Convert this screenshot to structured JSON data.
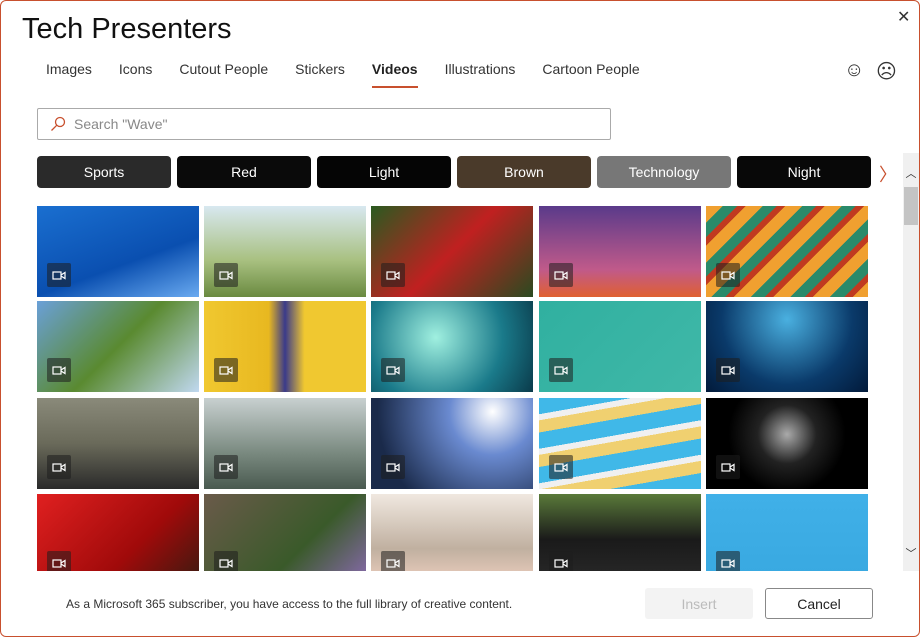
{
  "window": {
    "title": "Tech Presenters",
    "close_icon": "close-icon"
  },
  "tabs": [
    {
      "label": "Images"
    },
    {
      "label": "Icons"
    },
    {
      "label": "Cutout People"
    },
    {
      "label": "Stickers"
    },
    {
      "label": "Videos",
      "active": true
    },
    {
      "label": "Illustrations"
    },
    {
      "label": "Cartoon People"
    }
  ],
  "feedback": {
    "happy": "☺",
    "sad": "☹"
  },
  "search": {
    "placeholder": "Search \"Wave\"",
    "value": ""
  },
  "chips": [
    {
      "label": "Sports",
      "bg": "#2a2a2a"
    },
    {
      "label": "Red",
      "bg": "#0a0a0a"
    },
    {
      "label": "Light",
      "bg": "#050505"
    },
    {
      "label": "Brown",
      "bg": "#4a3a2a"
    },
    {
      "label": "Technology",
      "bg": "#777777"
    },
    {
      "label": "Night",
      "bg": "#080808"
    }
  ],
  "thumbnails": [
    [
      "linear-gradient(160deg,#1a6fd0,#0a4fb0 60%,#6aaaf0)",
      "linear-gradient(180deg,#d8e8f0,#a8c080 60%,#6a8a40)",
      "linear-gradient(135deg,#2a5a20,#c02020 50%,#2a4a20)",
      "linear-gradient(180deg,#5a3a8a,#c05a8a 70%,#e06030)",
      "repeating-linear-gradient(135deg,#f0a030 0 12px,#2a8a6a 12px 22px,#c03a20 22px 28px)"
    ],
    [
      "linear-gradient(135deg,#6aa0d8,#5a8a30 50%,#c0d8f0)",
      "linear-gradient(90deg,#f0c830,#e8b820 40%,#3a3a8a 50%,#f0c830 62%)",
      "radial-gradient(circle at 40% 40%,#a0f0e0,#1a7a8a 60%,#0a3a4a)",
      "linear-gradient(135deg,#30b0a0,#40b8a8)",
      "radial-gradient(circle at 50% 20%,#4ab0e0,#0a3a6a 60%,#021a3a)"
    ],
    [
      "linear-gradient(180deg,#8a8a7a,#6a6a5a 50%,#2a2a2a)",
      "linear-gradient(180deg,#c8d0d0,#7a8a80 60%,#4a5a50)",
      "radial-gradient(circle at 75% 15%,#fff,#6a8ad0 30%,#1a2a4a 80%)",
      "repeating-linear-gradient(170deg,#40b8e8 0 16px,#f0f0f0 16px 22px,#f0d070 22px 34px)",
      "radial-gradient(circle at 50% 40%,#aaa,#222 30%,#000 60%)"
    ],
    [
      "linear-gradient(135deg,#e02020,#a00a0a 60%,#3a1a10)",
      "linear-gradient(135deg,#6a5a4a,#3a5a2a 60%,#8a6ab0)",
      "linear-gradient(180deg,#f0e8e0,#c0b0a0 60%,#f0d0c0)",
      "linear-gradient(180deg,#5a7a3a,#1a1a1a 50%,#2a2a2a)",
      "linear-gradient(180deg,#40b0e8,#38a8e0)"
    ]
  ],
  "footer": {
    "subscriber_text": "As a Microsoft 365 subscriber, you have access to the full library of creative content.",
    "insert_label": "Insert",
    "cancel_label": "Cancel"
  },
  "colors": {
    "accent": "#c8502e"
  }
}
